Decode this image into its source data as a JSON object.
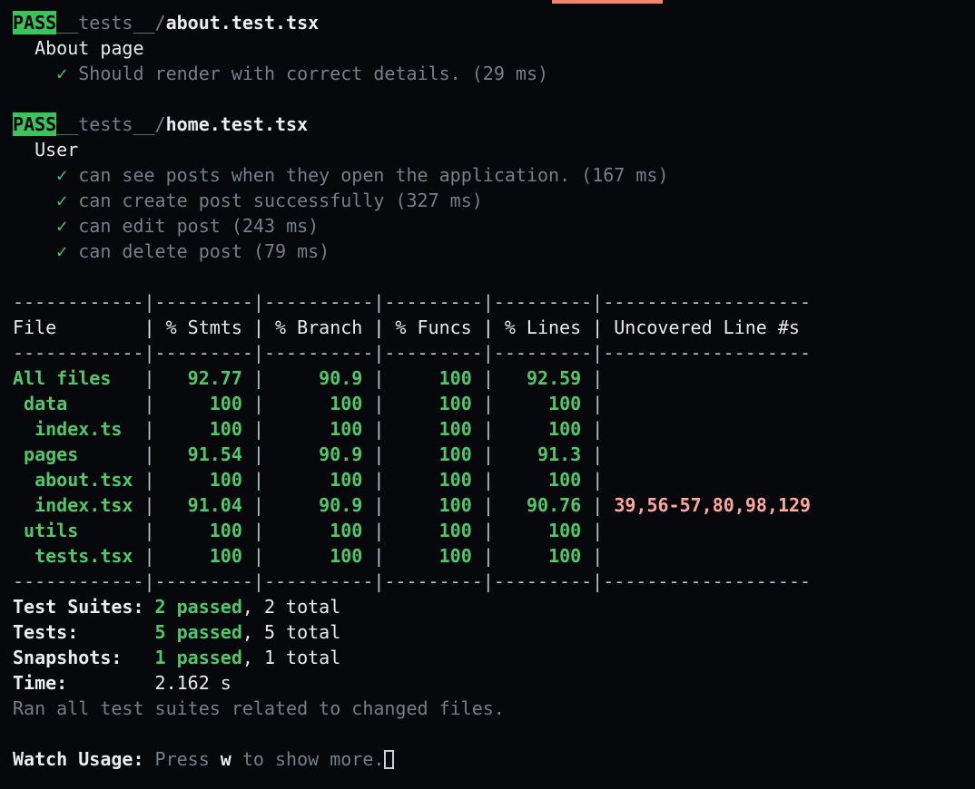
{
  "terminal": {
    "top_accent_color": "#f0866d",
    "background": "#06080b",
    "pass_badge_color": "#3dc35b",
    "uncovered_color": "#ffa79b"
  },
  "suites": [
    {
      "status": "PASS",
      "dir": "__tests__/",
      "file": "about.test.tsx",
      "describe": "About page",
      "tests": [
        {
          "check": "✓",
          "name": "Should render with correct details.",
          "duration": "(29 ms)"
        }
      ]
    },
    {
      "status": "PASS",
      "dir": "__tests__/",
      "file": "home.test.tsx",
      "describe": "User",
      "tests": [
        {
          "check": "✓",
          "name": "can see posts when they open the application.",
          "duration": "(167 ms)"
        },
        {
          "check": "✓",
          "name": "can create post successfully",
          "duration": "(327 ms)"
        },
        {
          "check": "✓",
          "name": "can edit post",
          "duration": "(243 ms)"
        },
        {
          "check": "✓",
          "name": "can delete post",
          "duration": "(79 ms)"
        }
      ]
    }
  ],
  "coverage": {
    "columns": [
      "File",
      "% Stmts",
      "% Branch",
      "% Funcs",
      "% Lines",
      "Uncovered Line #s"
    ],
    "rule_top": "------------|---------|----------|---------|---------|-------------------",
    "rule_header": "------------|---------|----------|---------|---------|-------------------",
    "rule_bottom": "------------|---------|----------|---------|---------|-------------------",
    "header_row": "File        | % Stmts | % Branch | % Funcs | % Lines | Uncovered Line #s ",
    "rows": [
      {
        "file": "All files",
        "indent": 0,
        "stmts": "92.77",
        "branch": "90.9",
        "funcs": "100",
        "lines": "92.59",
        "uncovered": ""
      },
      {
        "file": "data",
        "indent": 1,
        "stmts": "100",
        "branch": "100",
        "funcs": "100",
        "lines": "100",
        "uncovered": ""
      },
      {
        "file": "index.ts",
        "indent": 2,
        "stmts": "100",
        "branch": "100",
        "funcs": "100",
        "lines": "100",
        "uncovered": ""
      },
      {
        "file": "pages",
        "indent": 1,
        "stmts": "91.54",
        "branch": "90.9",
        "funcs": "100",
        "lines": "91.3",
        "uncovered": ""
      },
      {
        "file": "about.tsx",
        "indent": 2,
        "stmts": "100",
        "branch": "100",
        "funcs": "100",
        "lines": "100",
        "uncovered": ""
      },
      {
        "file": "index.tsx",
        "indent": 2,
        "stmts": "91.04",
        "branch": "90.9",
        "funcs": "100",
        "lines": "90.76",
        "uncovered": "39,56-57,80,98,129"
      },
      {
        "file": "utils",
        "indent": 1,
        "stmts": "100",
        "branch": "100",
        "funcs": "100",
        "lines": "100",
        "uncovered": ""
      },
      {
        "file": "tests.tsx",
        "indent": 2,
        "stmts": "100",
        "branch": "100",
        "funcs": "100",
        "lines": "100",
        "uncovered": ""
      }
    ]
  },
  "summary": {
    "test_suites_label": "Test Suites:",
    "test_suites_passed": "2 passed",
    "test_suites_total": ", 2 total",
    "tests_label": "Tests:",
    "tests_passed": "5 passed",
    "tests_total": ", 5 total",
    "snapshots_label": "Snapshots:",
    "snapshots_passed": "1 passed",
    "snapshots_total": ", 1 total",
    "time_label": "Time:",
    "time_value": "2.162 s",
    "ran_note": "Ran all test suites related to changed files."
  },
  "watch": {
    "label": "Watch Usage:",
    "hint_pre": "Press ",
    "hint_key": "w",
    "hint_post": " to show more."
  }
}
